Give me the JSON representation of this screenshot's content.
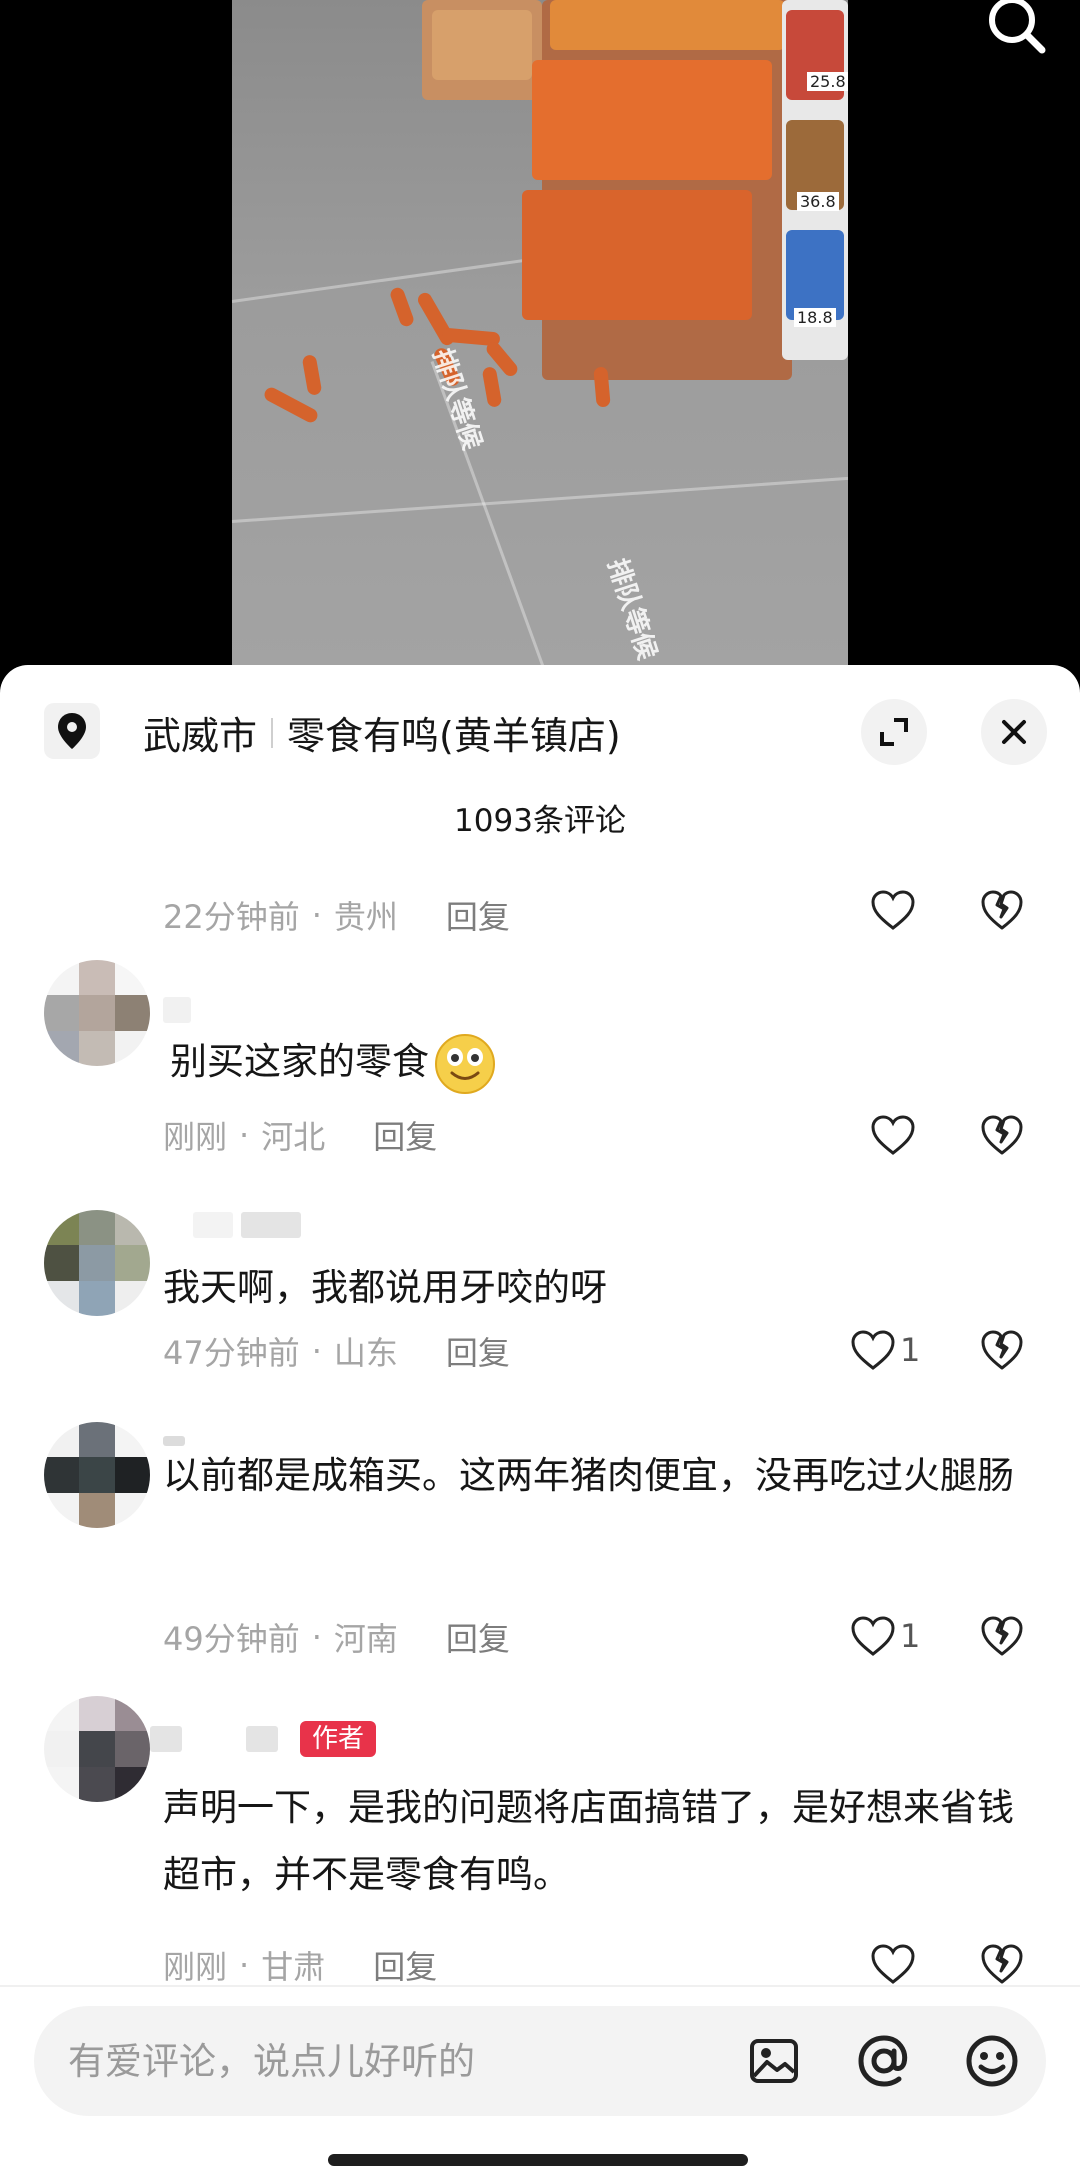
{
  "location": {
    "city": "武威市",
    "store": "零食有鸣(黄羊镇店)"
  },
  "comments_count": "1093条评论",
  "icons": {
    "search": "search-icon",
    "location": "location-pin-icon",
    "expand": "expand-icon",
    "close": "close-icon",
    "like": "heart-icon",
    "dislike": "broken-heart-icon",
    "image": "image-icon",
    "mention": "at-icon",
    "emoji": "smiley-icon"
  },
  "comments": [
    {
      "text": "",
      "time": "22分钟前",
      "region": "贵州",
      "reply": "回复",
      "likes": "",
      "author": false
    },
    {
      "text": "别买这家的零食",
      "time": "刚刚",
      "region": "河北",
      "reply": "回复",
      "likes": "",
      "author": false
    },
    {
      "text": "我天啊，我都说用牙咬的呀",
      "time": "47分钟前",
      "region": "山东",
      "reply": "回复",
      "likes": "1",
      "author": false
    },
    {
      "text": "以前都是成箱买。这两年猪肉便宜，没再吃过火腿肠",
      "time": "49分钟前",
      "region": "河南",
      "reply": "回复",
      "likes": "1",
      "author": false
    },
    {
      "text": "声明一下，是我的问题将店面搞错了，是好想来省钱超市，并不是零食有鸣。",
      "time": "刚刚",
      "region": "甘肃",
      "reply": "回复",
      "likes": "",
      "author": true,
      "author_label": "作者"
    }
  ],
  "meta_separator": "·",
  "input": {
    "placeholder": "有爱评论，说点儿好听的"
  },
  "video": {
    "price_tags": [
      "25.8",
      "36.8",
      "18.8"
    ]
  },
  "colors": {
    "accent_badge": "#e8334a",
    "sheet_bg": "#ffffff",
    "meta_text": "#a5a5a5"
  }
}
